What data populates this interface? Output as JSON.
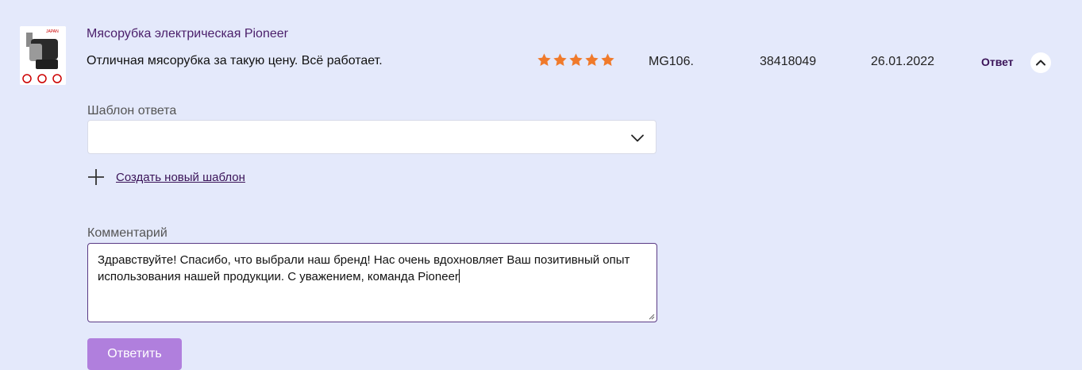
{
  "review": {
    "product_name": "Мясорубка электрическая Pioneer",
    "text": "Отличная мясорубка за такую цену. Всё работает.",
    "rating": 5,
    "model": "MG106.",
    "article": "38418049",
    "date": "26.01.2022",
    "answer_label": "Ответ",
    "thumbnail_badge": "JAPAN"
  },
  "colors": {
    "background": "#e4e9fb",
    "star": "#f07a2b",
    "accent": "#b07fdd",
    "title": "#4a1e6a"
  },
  "form": {
    "template_label": "Шаблон ответа",
    "template_value": "",
    "create_template_link": "Создать новый шаблон",
    "comment_label": "Комментарий",
    "comment_text": "Здравствуйте! Спасибо, что выбрали наш бренд! Нас очень вдохновляет Ваш позитивный опыт использования нашей продукции. С уважением, команда Pioneer",
    "submit_label": "Ответить"
  },
  "icons": [
    "chevron-up-icon",
    "chevron-down-icon",
    "plus-icon",
    "star-icon",
    "resize-handle-icon"
  ]
}
